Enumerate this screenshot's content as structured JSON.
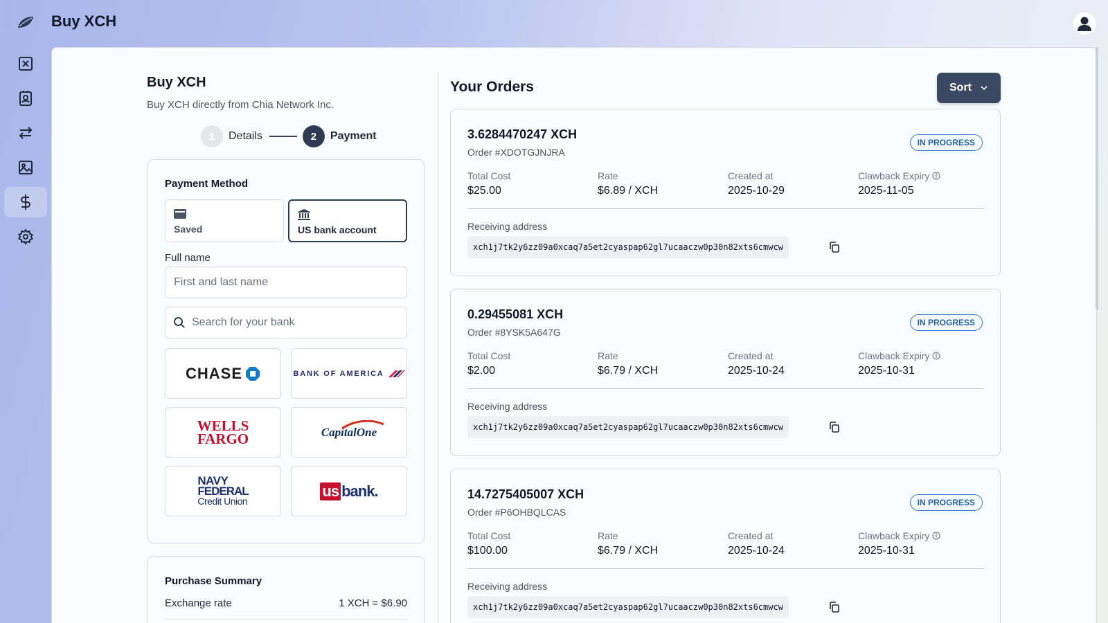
{
  "app": {
    "title": "Buy XCH"
  },
  "sidebar": {
    "items": [
      {
        "icon": "chia-x-icon",
        "active": false
      },
      {
        "icon": "contacts-icon",
        "active": false
      },
      {
        "icon": "swap-arrows-icon",
        "active": false
      },
      {
        "icon": "image-icon",
        "active": false
      },
      {
        "icon": "dollar-icon",
        "active": true
      },
      {
        "icon": "gear-icon",
        "active": false
      }
    ]
  },
  "buy": {
    "title": "Buy XCH",
    "subtitle": "Buy XCH directly from Chia Network Inc.",
    "steps": [
      {
        "number": "1",
        "label": "Details",
        "state": "done"
      },
      {
        "number": "2",
        "label": "Payment",
        "state": "current"
      }
    ],
    "payment_method": {
      "title": "Payment Method",
      "tabs": [
        {
          "label": "Saved",
          "icon": "wallet-icon",
          "selected": false
        },
        {
          "label": "US bank account",
          "icon": "bank-icon",
          "selected": true
        }
      ],
      "full_name_label": "Full name",
      "full_name_placeholder": "First and last name",
      "bank_search_placeholder": "Search for your bank",
      "banks": {
        "chase": "CHASE",
        "boa": "BANK OF AMERICA",
        "wells_1": "WELLS",
        "wells_2": "FARGO",
        "capone": "CapitalOne",
        "navy_1": "NAVY",
        "navy_2": "FEDERAL",
        "navy_3": "Credit Union",
        "usbank_us": "us",
        "usbank_bank": "bank."
      }
    },
    "summary": {
      "title": "Purchase Summary",
      "exchange_rate_label": "Exchange rate",
      "exchange_rate_value": "1 XCH = $6.90"
    }
  },
  "orders": {
    "title": "Your Orders",
    "sort_label": "Sort",
    "labels": {
      "total_cost": "Total Cost",
      "rate": "Rate",
      "created_at": "Created at",
      "clawback_expiry": "Clawback Expiry",
      "receiving_address": "Receiving address"
    },
    "items": [
      {
        "amount": "3.6284470247 XCH",
        "order_id": "Order #XDOTGJNJRA",
        "status": "IN PROGRESS",
        "total_cost": "$25.00",
        "rate": "$6.89 / XCH",
        "created_at": "2025-10-29",
        "clawback_expiry": "2025-11-05",
        "address": "xch1j7tk2y6zz09a0xcaq7a5et2cyaspap62gl7ucaaczw0p30n82xts6cmwcw"
      },
      {
        "amount": "0.29455081 XCH",
        "order_id": "Order #8YSK5A647G",
        "status": "IN PROGRESS",
        "total_cost": "$2.00",
        "rate": "$6.79 / XCH",
        "created_at": "2025-10-24",
        "clawback_expiry": "2025-10-31",
        "address": "xch1j7tk2y6zz09a0xcaq7a5et2cyaspap62gl7ucaaczw0p30n82xts6cmwcw"
      },
      {
        "amount": "14.7275405007 XCH",
        "order_id": "Order #P6OHBQLCAS",
        "status": "IN PROGRESS",
        "total_cost": "$100.00",
        "rate": "$6.79 / XCH",
        "created_at": "2025-10-24",
        "clawback_expiry": "2025-10-31",
        "address": "xch1j7tk2y6zz09a0xcaq7a5et2cyaspap62gl7ucaaczw0p30n82xts6cmwcw"
      }
    ]
  }
}
